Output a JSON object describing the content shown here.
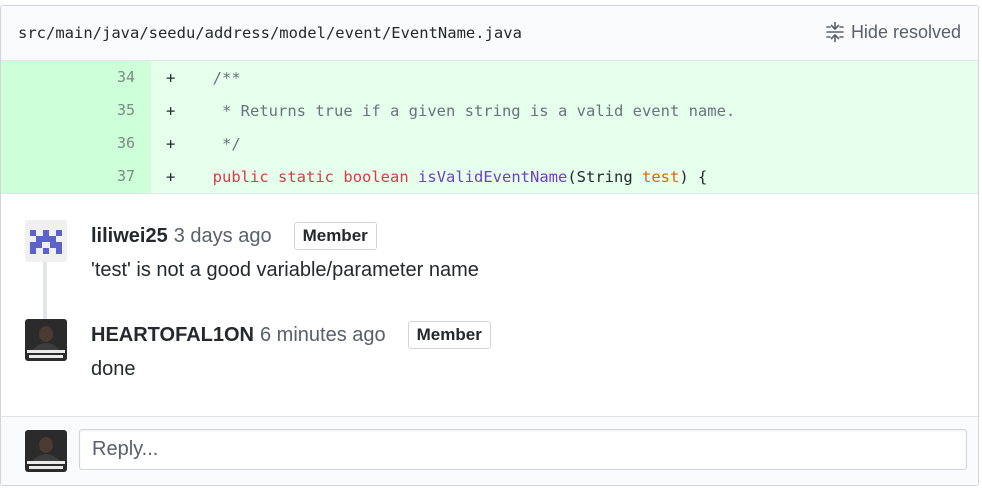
{
  "file": {
    "path": "src/main/java/seedu/address/model/event/EventName.java",
    "hide_resolved_label": "Hide resolved",
    "hide_resolved_icon": "fold-icon"
  },
  "diff": {
    "lines": [
      {
        "num": "34",
        "marker": "+",
        "indent": "    ",
        "tokens": [
          {
            "t": "/**",
            "c": "comment"
          }
        ]
      },
      {
        "num": "35",
        "marker": "+",
        "indent": "     ",
        "tokens": [
          {
            "t": "* Returns true if a given string is a valid event name.",
            "c": "comment"
          }
        ]
      },
      {
        "num": "36",
        "marker": "+",
        "indent": "     ",
        "tokens": [
          {
            "t": "*/",
            "c": "comment"
          }
        ]
      },
      {
        "num": "37",
        "marker": "+",
        "indent": "    ",
        "tokens": [
          {
            "t": "public",
            "c": "keyword"
          },
          {
            "t": " ",
            "c": ""
          },
          {
            "t": "static",
            "c": "keyword"
          },
          {
            "t": " ",
            "c": ""
          },
          {
            "t": "boolean",
            "c": "keyword"
          },
          {
            "t": " ",
            "c": ""
          },
          {
            "t": "isValidEventName",
            "c": "func"
          },
          {
            "t": "(String ",
            "c": ""
          },
          {
            "t": "test",
            "c": "param"
          },
          {
            "t": ") {",
            "c": ""
          }
        ]
      }
    ]
  },
  "comments": [
    {
      "author": "liliwei25",
      "time": "3 days ago",
      "badge": "Member",
      "body": "'test' is not a good variable/parameter name",
      "avatar": "identicon-avatar"
    },
    {
      "author": "HEARTOFAL1ON",
      "time": "6 minutes ago",
      "badge": "Member",
      "body": "done",
      "avatar": "photo-avatar",
      "avatar_caption": "I WAS WILLING TO PUT IN THE WORK"
    }
  ],
  "reply": {
    "placeholder": "Reply...",
    "value": ""
  },
  "colors": {
    "added_bg": "#e6ffed",
    "added_num_bg": "#cdffd8",
    "keyword": "#d73a49",
    "function": "#6f42c1",
    "param": "#e36209",
    "comment": "#6a737d",
    "identicon": "#5b62c9"
  }
}
